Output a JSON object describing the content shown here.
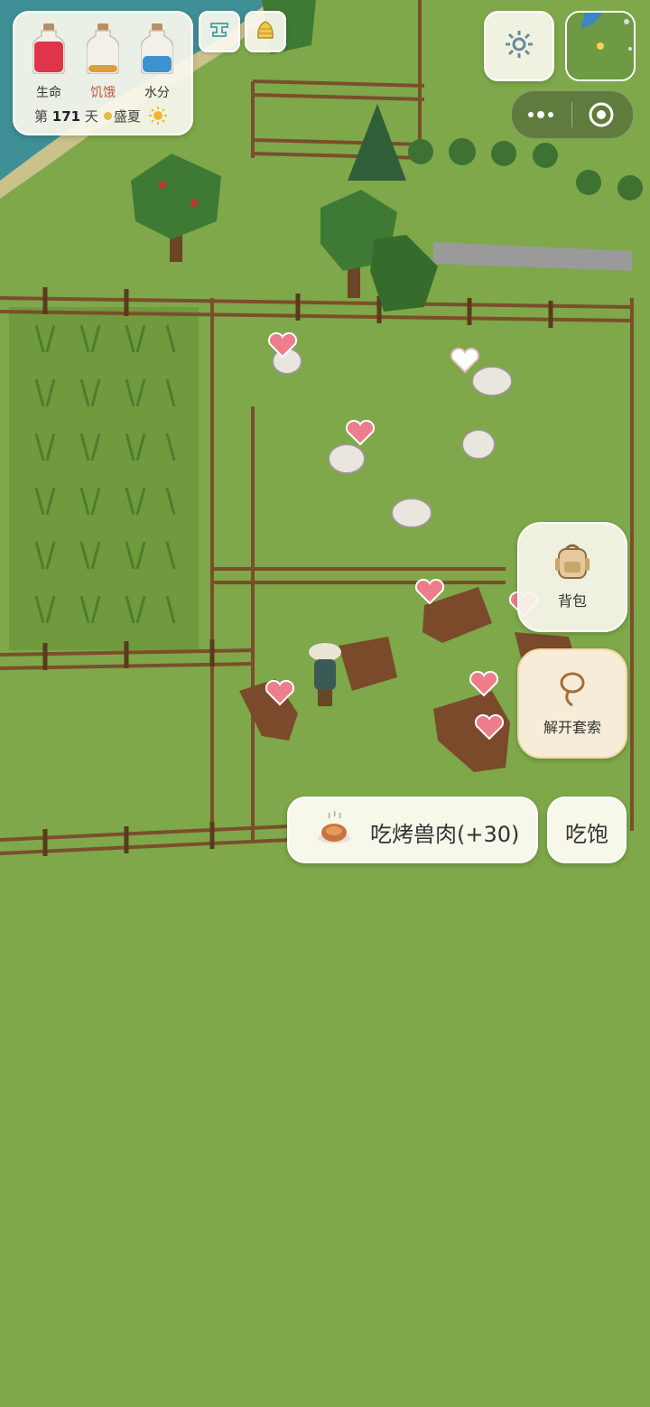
{
  "stats": {
    "health_label": "生命",
    "hunger_label": "饥饿",
    "water_label": "水分",
    "health_level": 0.85,
    "hunger_level": 0.2,
    "water_level": 0.45,
    "day_prefix": "第",
    "day_number": "171",
    "day_suffix": "天",
    "season": "盛夏",
    "colors": {
      "health": "#e0344a",
      "hunger": "#d8a03a",
      "water": "#3c93d0"
    }
  },
  "toolbar": {
    "crafting_icon": "anvil-icon",
    "beehive_icon": "beehive-icon",
    "settings_icon": "gear-icon"
  },
  "side_actions": {
    "backpack_label": "背包",
    "lasso_label": "解开套索"
  },
  "actions": {
    "eat_label": "吃烤兽肉(+30)",
    "full_label": "吃饱"
  }
}
